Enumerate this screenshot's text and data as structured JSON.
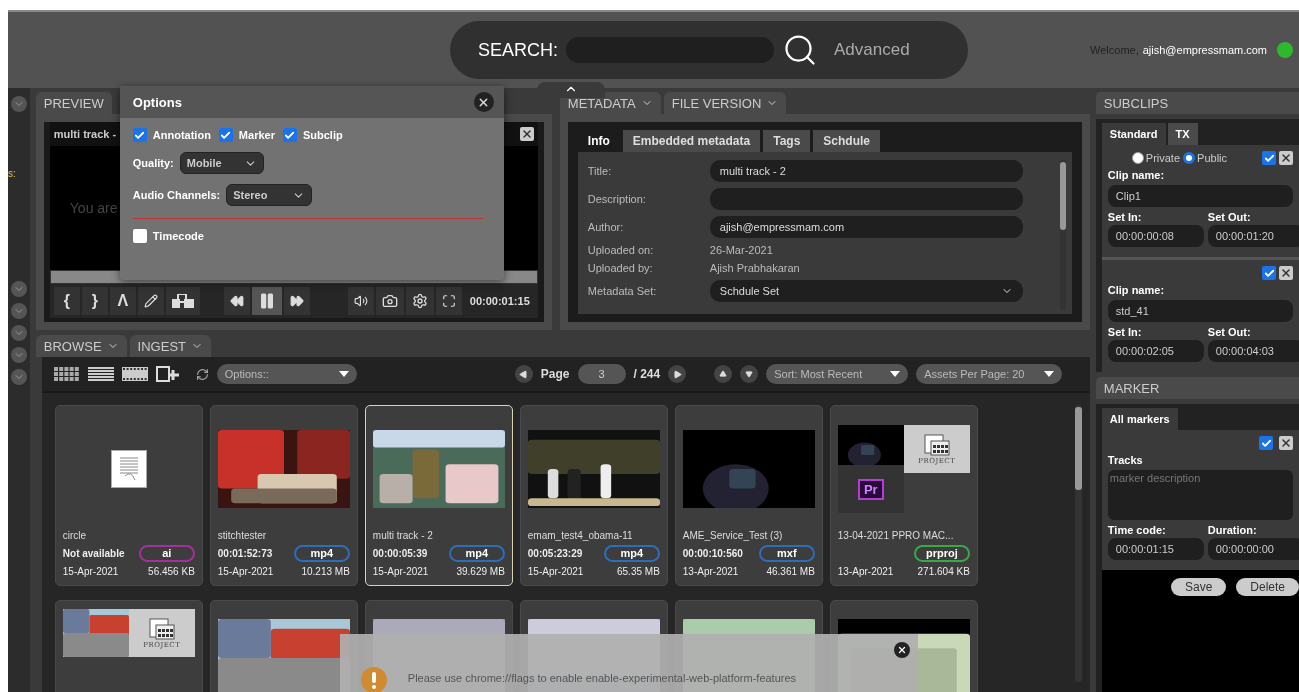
{
  "header": {
    "search_label": "SEARCH:",
    "advanced": "Advanced",
    "welcome": "Welcome,",
    "user": "ajish@empressmam.com",
    "online": true
  },
  "left_strip": {
    "label": "s:"
  },
  "preview": {
    "tab": "PREVIEW",
    "clip_title": "multi track -",
    "message": "You are",
    "mark_buttons": [
      "{",
      "}",
      "Λ"
    ],
    "timecode": "00:00:01:15"
  },
  "options": {
    "title": "Options",
    "toggles": [
      {
        "label": "Annotation",
        "checked": true
      },
      {
        "label": "Marker",
        "checked": true
      },
      {
        "label": "Subclip",
        "checked": true
      }
    ],
    "quality_label": "Quality:",
    "quality": "Mobile",
    "audio_label": "Audio Channels:",
    "audio": "Stereo",
    "timecode": {
      "label": "Timecode",
      "checked": false
    }
  },
  "metadata": {
    "tabs": [
      "METADATA",
      "FILE VERSION"
    ],
    "subtabs": [
      {
        "label": "Info",
        "selected": true
      },
      {
        "label": "Embedded metadata",
        "selected": false
      },
      {
        "label": "Tags",
        "selected": false
      },
      {
        "label": "Schdule",
        "selected": false
      }
    ],
    "fields": [
      {
        "kind": "input",
        "label": "Title:",
        "value": "multi track - 2"
      },
      {
        "kind": "input",
        "label": "Description:"
      },
      {
        "kind": "input",
        "label": "Author:",
        "value": "ajish@empressmam.com"
      },
      {
        "kind": "text",
        "label": "Uploaded on:",
        "value": "26-Mar-2021"
      },
      {
        "kind": "text",
        "label": "Uploaded by:",
        "value": "Ajish Prabhakaran"
      },
      {
        "kind": "select",
        "label": "Metadata Set:",
        "value": "Schdule Set"
      }
    ]
  },
  "browse": {
    "tabs": [
      "BROWSE",
      "INGEST"
    ],
    "options": "Options::",
    "page_label": "Page",
    "page": "3",
    "page_total": "/ 244",
    "sort": "Sort: Most Recent",
    "per_page": "Assets Per Page: 20",
    "assets": [
      {
        "kind": "document",
        "name": "circle",
        "duration": "Not available",
        "type": "ai",
        "color": "#a3309c",
        "date": "15-Apr-2021",
        "size": "56.456 KB",
        "selected": false
      },
      {
        "kind": "picture",
        "name": "stitchtester",
        "duration": "00:01:52:73",
        "type": "mp4",
        "color": "#2f6db8",
        "date": "15-Apr-2021",
        "size": "10.213 MB",
        "selected": false
      },
      {
        "kind": "picture",
        "name": "multi track - 2",
        "duration": "00:00:05:39",
        "type": "mp4",
        "color": "#2f6db8",
        "date": "15-Apr-2021",
        "size": "39.629 MB",
        "selected": true
      },
      {
        "kind": "picture",
        "name": "emam_test4_obama-11",
        "duration": "00:05:23:29",
        "type": "mp4",
        "color": "#2f6db8",
        "date": "15-Apr-2021",
        "size": "65.35 MB",
        "selected": false
      },
      {
        "kind": "picture",
        "name": "AME_Service_Test (3)",
        "duration": "00:00:10:560",
        "type": "mxf",
        "color": "#2f6db8",
        "date": "13-Apr-2021",
        "size": "46.361 MB",
        "selected": false
      },
      {
        "kind": "project",
        "project_label": "PROJECT",
        "app_label": "Pr",
        "name": "13-04-2021 PPRO MAC...",
        "type": "prproj",
        "color": "#3aa845",
        "date": "13-Apr-2021",
        "size": "271.604 KB",
        "selected": false
      }
    ],
    "more_assets": [
      {
        "kind": "project",
        "project_label": "PROJECT"
      },
      {
        "kind": "picture"
      },
      {
        "kind": "picture"
      },
      {
        "kind": "picture"
      },
      {
        "kind": "picture"
      },
      {
        "kind": "picture"
      }
    ]
  },
  "subclips": {
    "title": "SUBCLIPS",
    "tabs": [
      {
        "label": "Standard",
        "selected": true
      },
      {
        "label": "TX",
        "selected": false
      }
    ],
    "visibility": [
      {
        "label": "Private",
        "selected": false
      },
      {
        "label": "Public",
        "selected": true
      }
    ],
    "clips": [
      {
        "name_label": "Clip name:",
        "name": "Clip1",
        "in_label": "Set In:",
        "in": "00:00:00:08",
        "out_label": "Set Out:",
        "out": "00:00:01:20",
        "checked": true
      },
      {
        "name_label": "Clip name:",
        "name": "std_41",
        "in_label": "Set In:",
        "in": "00:00:02:05",
        "out_label": "Set Out:",
        "out": "00:00:04:03",
        "checked": true
      }
    ]
  },
  "marker": {
    "title": "MARKER",
    "tabs": [
      {
        "label": "All markers",
        "selected": true
      }
    ],
    "checked": true,
    "tracks_label": "Tracks",
    "placeholder": "marker description",
    "time_label": "Time code:",
    "time": "00:00:01:15",
    "duration_label": "Duration:",
    "duration": "00:00:00:00",
    "buttons": [
      "Save",
      "Delete"
    ]
  },
  "toast": {
    "message": "Please use chrome://flags to enable enable-experimental-web-platform-features"
  }
}
